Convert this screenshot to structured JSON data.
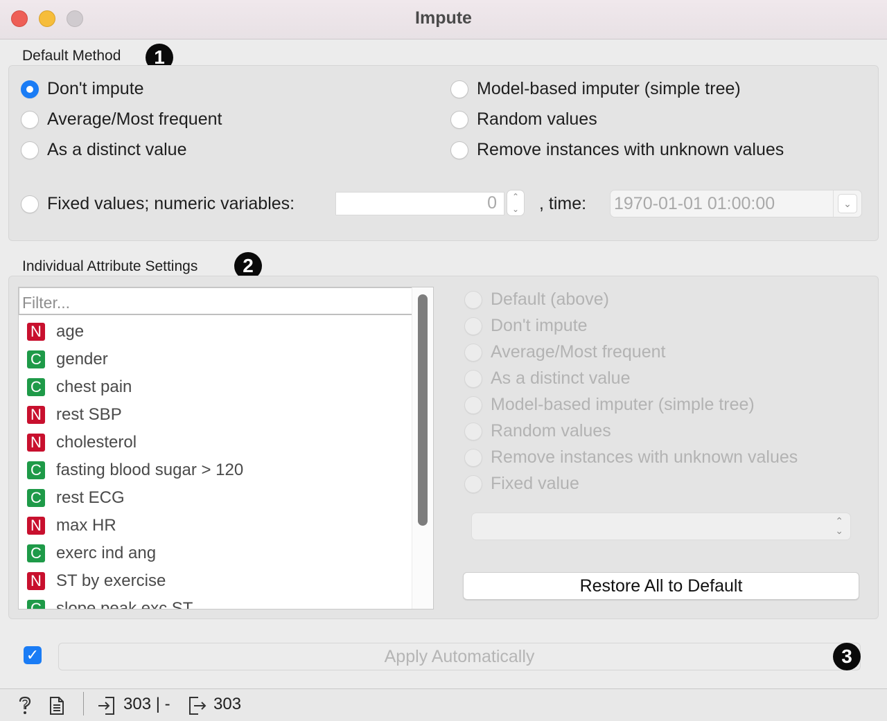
{
  "window": {
    "title": "Impute"
  },
  "default_method": {
    "label": "Default Method",
    "badge": "1",
    "options_left": [
      {
        "label": "Don't impute",
        "checked": true
      },
      {
        "label": "Average/Most frequent",
        "checked": false
      },
      {
        "label": "As a distinct value",
        "checked": false
      }
    ],
    "options_right": [
      {
        "label": "Model-based imputer (simple tree)",
        "checked": false
      },
      {
        "label": "Random values",
        "checked": false
      },
      {
        "label": "Remove instances with unknown values",
        "checked": false
      }
    ],
    "fixed_label": "Fixed values; numeric variables:",
    "numeric_value": "0",
    "time_label": ", time:",
    "time_value": "1970-01-01 01:00:00"
  },
  "individual": {
    "label": "Individual Attribute Settings",
    "badge": "2",
    "filter_placeholder": "Filter...",
    "attributes": [
      {
        "type": "N",
        "name": "age"
      },
      {
        "type": "C",
        "name": "gender"
      },
      {
        "type": "C",
        "name": "chest pain"
      },
      {
        "type": "N",
        "name": "rest SBP"
      },
      {
        "type": "N",
        "name": "cholesterol"
      },
      {
        "type": "C",
        "name": "fasting blood sugar > 120"
      },
      {
        "type": "C",
        "name": "rest ECG"
      },
      {
        "type": "N",
        "name": "max HR"
      },
      {
        "type": "C",
        "name": "exerc ind ang"
      },
      {
        "type": "N",
        "name": "ST by exercise"
      },
      {
        "type": "C",
        "name": "slope peak exc ST"
      }
    ],
    "methods": [
      "Default (above)",
      "Don't impute",
      "Average/Most frequent",
      "As a distinct value",
      "Model-based imputer (simple tree)",
      "Random values",
      "Remove instances with unknown values",
      "Fixed value"
    ],
    "restore_label": "Restore All to Default"
  },
  "apply": {
    "label": "Apply Automatically",
    "checked": true,
    "badge": "3"
  },
  "status": {
    "input_count": "303 | -",
    "output_count": "303"
  },
  "colors": {
    "accent": "#1a7cf5",
    "numeric": "#c8102e",
    "categorical": "#1e9a48"
  }
}
